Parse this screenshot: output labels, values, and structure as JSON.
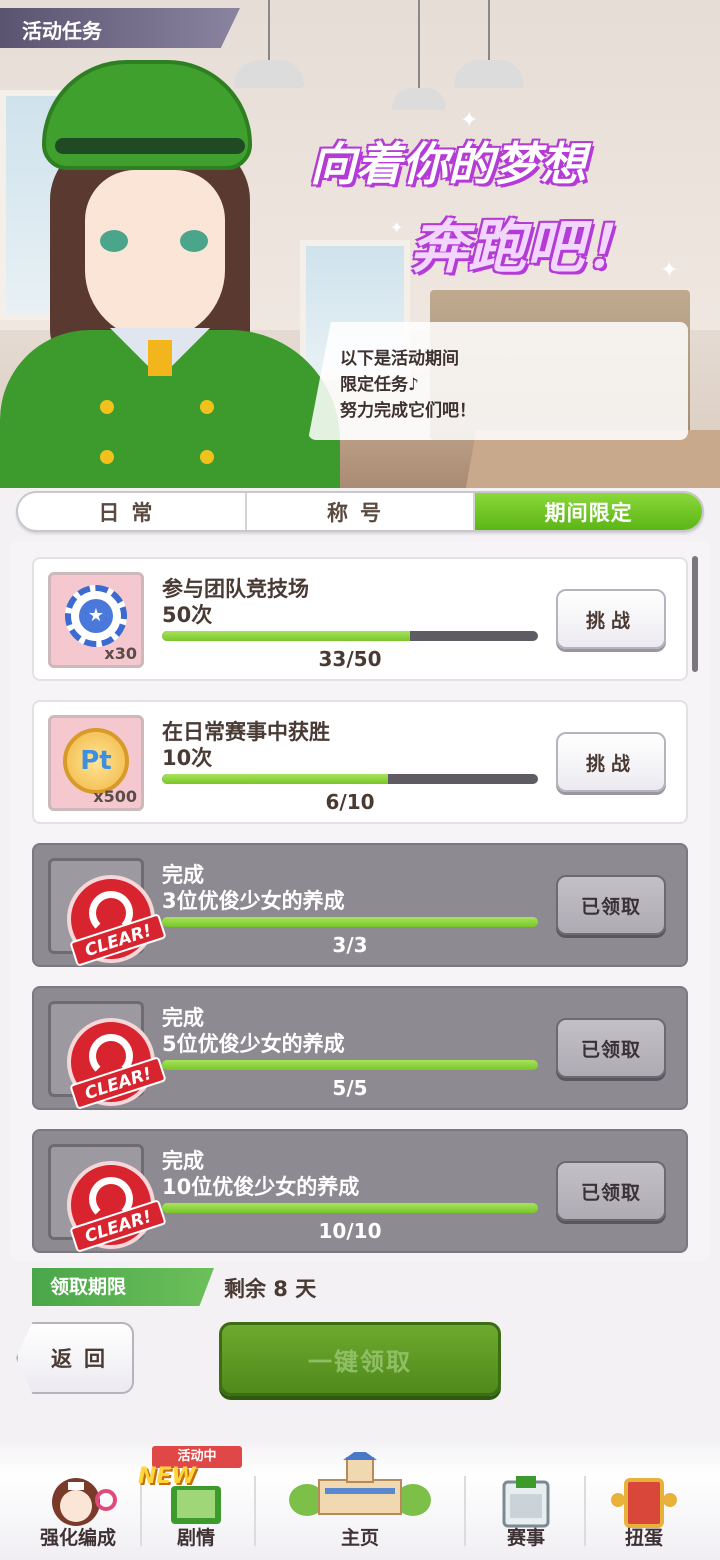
{
  "header": {
    "title": "活动任务"
  },
  "banner": {
    "logo_line1": "向着你的梦想",
    "logo_line2": "奔跑吧！",
    "speech": [
      "以下是活动期间",
      "限定任务♪",
      "努力完成它们吧！"
    ]
  },
  "tabs": [
    {
      "label": "日常",
      "active": false
    },
    {
      "label": "称号",
      "active": false
    },
    {
      "label": "期间限定",
      "active": true
    }
  ],
  "missions": [
    {
      "title1": "参与团队竞技场",
      "title2": "50次",
      "progress": "33/50",
      "current": 33,
      "total": 50,
      "button": "挑战",
      "reward_qty": "x30",
      "reward_icon": "coin-icon",
      "done": false
    },
    {
      "title1": "在日常赛事中获胜",
      "title2": "10次",
      "progress": "6/10",
      "current": 6,
      "total": 10,
      "button": "挑战",
      "reward_qty": "x500",
      "reward_icon": "pt-coin-icon",
      "done": false
    },
    {
      "title1": "完成",
      "title2": "3位优俊少女的养成",
      "progress": "3/3",
      "current": 3,
      "total": 3,
      "button": "已领取",
      "stamp": "CLEAR!",
      "done": true
    },
    {
      "title1": "完成",
      "title2": "5位优俊少女的养成",
      "progress": "5/5",
      "current": 5,
      "total": 5,
      "button": "已领取",
      "stamp": "CLEAR!",
      "done": true
    },
    {
      "title1": "完成",
      "title2": "10位优俊少女的养成",
      "progress": "10/10",
      "current": 10,
      "total": 10,
      "button": "已领取",
      "stamp": "CLEAR!",
      "done": true
    }
  ],
  "deadline": {
    "label": "领取期限",
    "remaining": "剩余 8 天"
  },
  "actions": {
    "back": "返回",
    "claim_all": "一键领取"
  },
  "nav": {
    "items": [
      "强化编成",
      "剧情",
      "主页",
      "赛事",
      "扭蛋"
    ],
    "event_badge": "活动中",
    "new_badge": "NEW"
  },
  "colors": {
    "accent_green": "#5cb516",
    "done_gray": "#8e8a92",
    "clear_red": "#d8242f"
  }
}
